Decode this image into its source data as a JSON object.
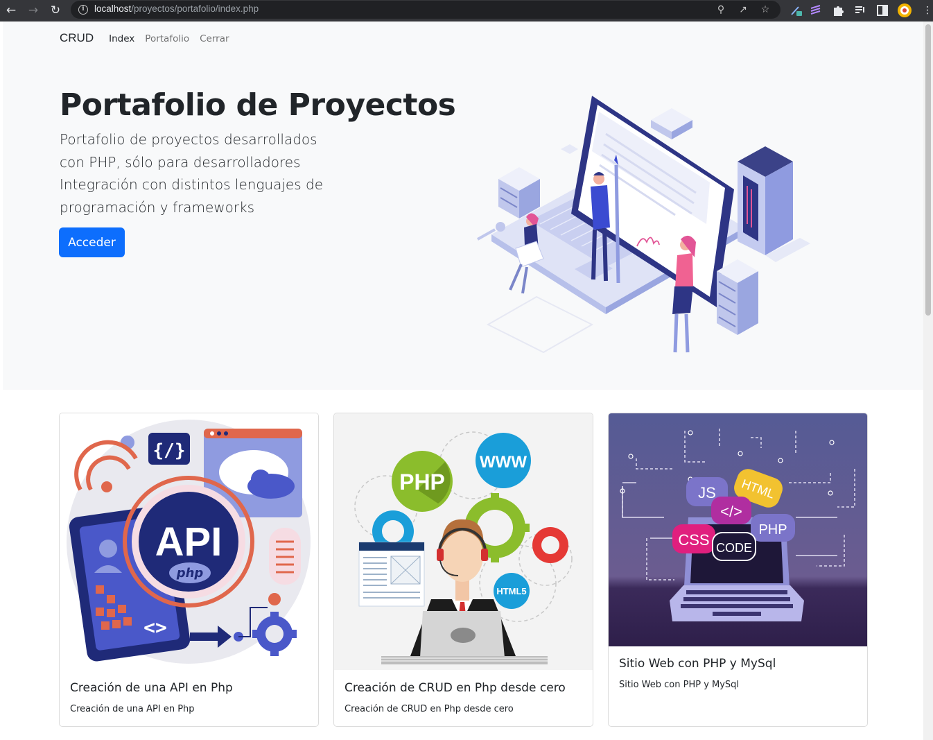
{
  "browser": {
    "url_host": "localhost",
    "url_path": "/proyectos/portafolio/index.php"
  },
  "nav": {
    "brand": "CRUD",
    "links": [
      "Index",
      "Portafolio",
      "Cerrar"
    ],
    "active": "Index"
  },
  "hero": {
    "title": "Portafolio de Proyectos",
    "lead": "Portafolio de proyectos desarrollados con PHP, sólo para desarrolladores Integración con distintos lenguajes de programación y frameworks",
    "button": "Acceder"
  },
  "cards": [
    {
      "title": "Creación de una API en Php",
      "text": "Creación de una API en Php",
      "image_labels": [
        "{/}",
        "API",
        "php",
        "<>"
      ]
    },
    {
      "title": "Creación de CRUD en Php desde cero",
      "text": "Creación de CRUD en Php desde cero",
      "image_labels": [
        "PHP",
        "WWW",
        "HTML5"
      ]
    },
    {
      "title": "Sitio Web con PHP y MySql",
      "text": "Sitio Web con PHP y MySql",
      "image_labels": [
        "JS",
        "HTML",
        "</>",
        "CSS",
        "PHP",
        "CODE"
      ]
    }
  ],
  "colors": {
    "primary": "#0d6efd",
    "hero_bg": "#f8f9fa",
    "chrome_bg": "#35363a"
  }
}
